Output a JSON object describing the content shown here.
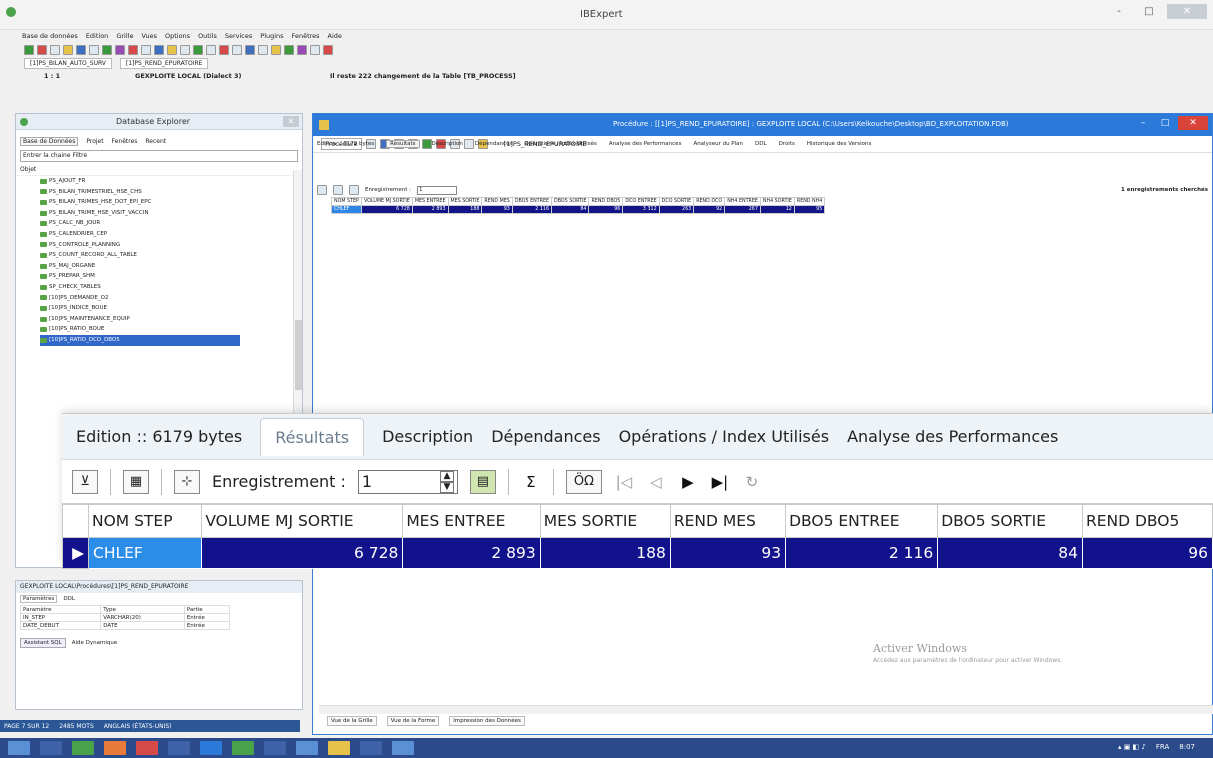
{
  "app": {
    "title": "IBExpert",
    "win_min": "-",
    "win_max": "□"
  },
  "menu": [
    "Base de données",
    "Edition",
    "Grille",
    "Vues",
    "Options",
    "Outils",
    "Services",
    "Plugins",
    "Fenêtres",
    "Aide"
  ],
  "connection_tabs": [
    "[1]PS_BILAN_AUTO_SURV",
    "[1]PS_REND_EPURATOIRE"
  ],
  "status": {
    "left": "1 : 1",
    "db": "GEXPLOITE LOCAL (Dialect 3)",
    "message": "Il reste 222 changement de la Table [TB_PROCESS]"
  },
  "explorer": {
    "title": "Database Explorer",
    "tabs": [
      "Base de Données",
      "Projet",
      "Fenêtres",
      "Recent"
    ],
    "filter_placeholder": "Entrer la chaine Filtre",
    "objects_label": "Objet",
    "items": [
      "PS_AJOUT_FR",
      "PS_BILAN_TRIMESTRIEL_HSE_CHS",
      "PS_BILAN_TRIMES_HSE_DOT_EPI_EPC",
      "PS_BILAN_TRIME_HSE_VISIT_VACCIN",
      "PS_CALC_NB_JOUR",
      "PS_CALENDRIER_CEP",
      "PS_CONTROLE_PLANNING",
      "PS_COUNT_RECORD_ALL_TABLE",
      "PS_MAJ_ORGANE",
      "PS_PREPAR_SHM",
      "SP_CHECK_TABLES",
      "[10]PS_DEMANDE_O2",
      "[10]PS_INDICE_BOUE",
      "[10]PS_MAINTENANCE_EQUIP",
      "[10]PS_RATIO_BOUE",
      "[10]PS_RATIO_DCO_DBO5"
    ]
  },
  "params": {
    "title": "GEXPLOITE LOCAL\\Procédures\\[1]PS_REND_EPURATOIRE",
    "tabs": [
      "Paramètres",
      "DDL"
    ],
    "headers": [
      "Paramètre",
      "Type",
      "Partie"
    ],
    "rows": [
      [
        "IN_STEP",
        "VARCHAR(20)",
        "Entrée"
      ],
      [
        "DATE_DEBUT",
        "DATE",
        "Entrée"
      ]
    ],
    "buttons": [
      "Assistant SQL",
      "Aide Dynamique"
    ]
  },
  "procedure": {
    "title": "Procédure : [[1]PS_REND_EPURATOIRE] : GEXPLOITE LOCAL (C:\\Users\\Kelkouche\\Desktop\\BD_EXPLOITATION.FDB)",
    "combo": "Procédure",
    "name": "[1]PS_REND_EPURATOIRE",
    "tabs": [
      "Edition :: 6179 bytes",
      "Résultats",
      "Description",
      "Dépendances",
      "Opérations / Index Utilisés",
      "Analyse des Performances",
      "Analyseur du Plan",
      "DDL",
      "Droits",
      "Historique des Versions"
    ],
    "record_label": "Enregistrement :",
    "record_value": "1",
    "count_text": "1 enregistrements cherchés",
    "bottom_tabs": [
      "Vue de la Grille",
      "Vue de la Forme",
      "Impression des Données"
    ]
  },
  "grid": {
    "columns": [
      "NOM STEP",
      "VOLUME MJ SORTIE",
      "MES ENTREE",
      "MES SORTIE",
      "REND MES",
      "DBO5 ENTREE",
      "DBO5 SORTIE",
      "REND DBO5",
      "DCO ENTREE",
      "DCO SORTIE",
      "REND DCO",
      "NH4 ENTREE",
      "NH4 SORTIE",
      "REND NH4"
    ],
    "row": [
      "CHLEF",
      "6 728",
      "2 893",
      "188",
      "93",
      "2 116",
      "84",
      "96",
      "3 312",
      "263",
      "92",
      "267",
      "12",
      "95"
    ]
  },
  "zoom": {
    "tabs": [
      "Edition :: 6179 bytes",
      "Résultats",
      "Description",
      "Dépendances",
      "Opérations / Index Utilisés",
      "Analyse des Performances"
    ],
    "record_label": "Enregistrement :",
    "record_value": "1"
  },
  "watermark": {
    "title": "Activer Windows",
    "text": "Accédez aux paramètres de l'ordinateur pour activer Windows."
  },
  "word_status": [
    "PAGE 7 SUR 12",
    "2485 MOTS",
    "ANGLAIS (ÉTATS-UNIS)"
  ],
  "tray": {
    "lang": "FRA",
    "time": "8:07"
  },
  "colors": {
    "selection": "#12128c",
    "selected_first": "#2b8de8",
    "title_blue": "#2b79d9",
    "taskbar": "#2a4a8a"
  }
}
